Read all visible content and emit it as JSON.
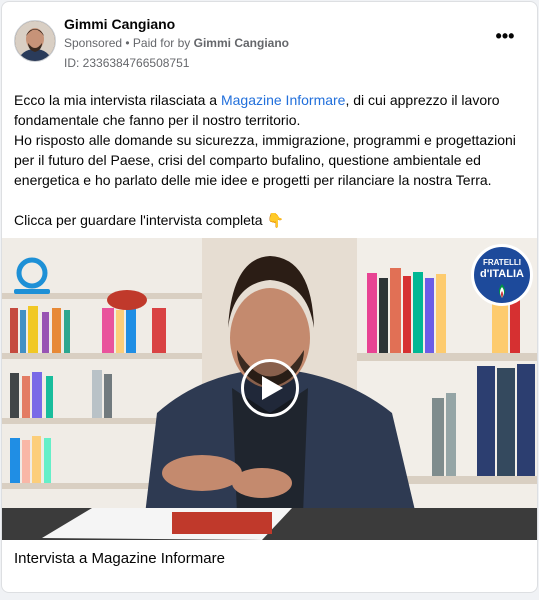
{
  "post": {
    "author": "Gimmi Cangiano",
    "sponsored": "Sponsored",
    "paid_prefix": "• Paid for by",
    "paid_by": "Gimmi Cangiano",
    "ad_id": "ID: 2336384766508751",
    "more_label": "•••",
    "text": {
      "p1_before": "Ecco la mia intervista rilasciata a ",
      "p1_link": "Magazine Informare",
      "p1_after": ", di cui apprezzo il lavoro fondamentale che fanno per il nostro territorio.",
      "p2": "Ho risposto alle domande su sicurezza, immigrazione, programmi e progettazioni per il futuro del Paese, crisi del comparto bufalino, questione ambientale ed energetica e ho parlato delle mie idee e progetti per rilanciare la nostra Terra.",
      "p3": "Clicca per guardare l'intervista completa 👇"
    },
    "media": {
      "logo_line1": "FRATELLI",
      "logo_line2": "d'ITALIA",
      "caption": "Intervista a Magazine Informare"
    }
  },
  "colors": {
    "link": "#216fdb",
    "text": "#050505",
    "secondary": "#65676b",
    "logo_blue": "#1d4a9b"
  },
  "icons": [
    "more-options-icon",
    "play-icon",
    "brand-logo-icon",
    "avatar"
  ]
}
